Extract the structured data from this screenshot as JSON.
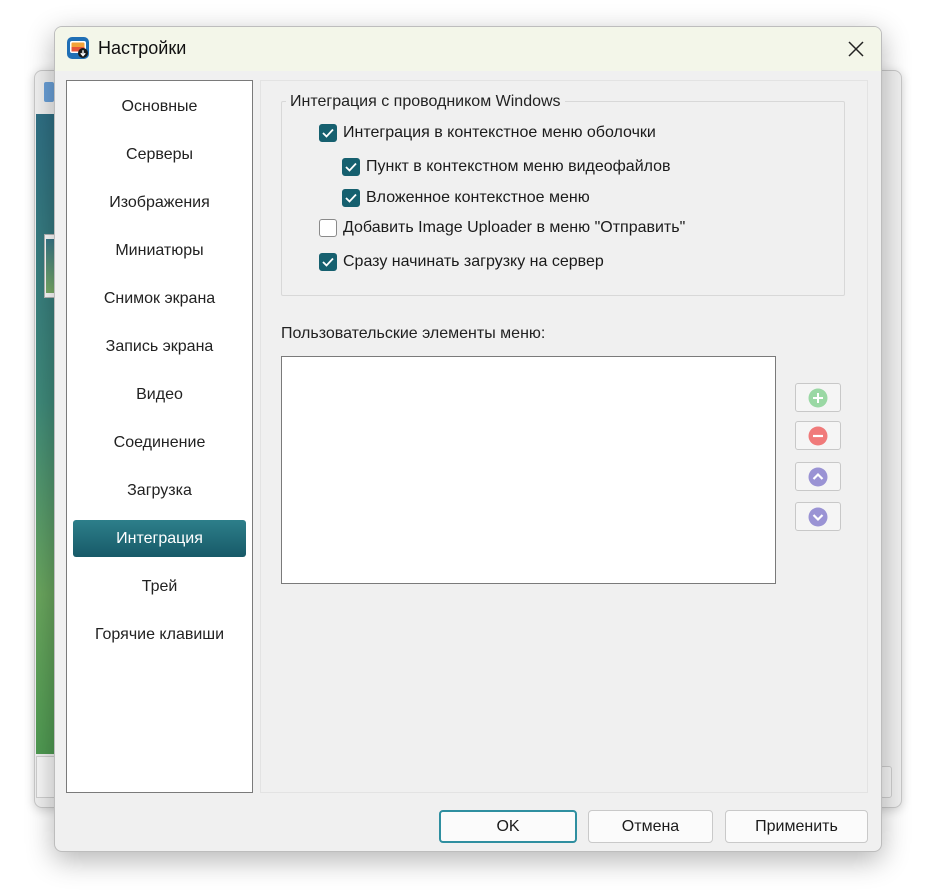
{
  "dialog": {
    "title": "Настройки",
    "accent_color": "#16606f"
  },
  "sidebar": {
    "items": [
      {
        "label": "Основные",
        "active": false
      },
      {
        "label": "Серверы",
        "active": false
      },
      {
        "label": "Изображения",
        "active": false
      },
      {
        "label": "Миниатюры",
        "active": false
      },
      {
        "label": "Снимок экрана",
        "active": false
      },
      {
        "label": "Запись экрана",
        "active": false
      },
      {
        "label": "Видео",
        "active": false
      },
      {
        "label": "Соединение",
        "active": false
      },
      {
        "label": "Загрузка",
        "active": false
      },
      {
        "label": "Интеграция",
        "active": true
      },
      {
        "label": "Трей",
        "active": false
      },
      {
        "label": "Горячие клавиши",
        "active": false
      }
    ]
  },
  "integration": {
    "group_title": "Интеграция с проводником Windows",
    "options": [
      {
        "label": "Интеграция в контекстное меню оболочки",
        "checked": true
      },
      {
        "label": "Пункт в контекстном меню видеофайлов",
        "checked": true
      },
      {
        "label": "Вложенное контекстное меню",
        "checked": true
      },
      {
        "label": "Добавить Image Uploader в меню \"Отправить\"",
        "checked": false
      },
      {
        "label": "Сразу начинать загрузку на сервер",
        "checked": true
      }
    ],
    "custom_menu_label": "Пользовательские элементы меню:",
    "custom_menu_items": []
  },
  "footer": {
    "ok_label": "OK",
    "cancel_label": "Отмена",
    "apply_label": "Применить"
  },
  "icons": {
    "app": "app-icon",
    "close": "close-icon",
    "add": "plus-circle-icon",
    "remove": "minus-circle-icon",
    "up": "chevron-up-circle-icon",
    "down": "chevron-down-circle-icon",
    "add_color": "#8fd19a",
    "remove_color": "#f07a7a",
    "move_color": "#9a93d4"
  }
}
